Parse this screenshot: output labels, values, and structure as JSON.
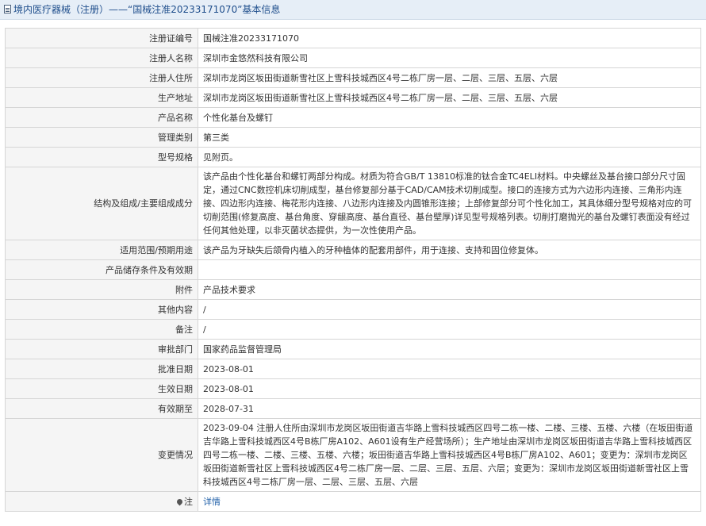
{
  "header": {
    "title": "境内医疗器械（注册）——“国械注准20233171070”基本信息",
    "icon": "document-icon"
  },
  "rows": [
    {
      "label": "注册证编号",
      "value": "国械注准20233171070"
    },
    {
      "label": "注册人名称",
      "value": "深圳市金悠然科技有限公司"
    },
    {
      "label": "注册人住所",
      "value": "深圳市龙岗区坂田街道新雪社区上雪科技城西区4号二栋厂房一层、二层、三层、五层、六层"
    },
    {
      "label": "生产地址",
      "value": "深圳市龙岗区坂田街道新雪社区上雪科技城西区4号二栋厂房一层、二层、三层、五层、六层"
    },
    {
      "label": "产品名称",
      "value": "个性化基台及螺钉"
    },
    {
      "label": "管理类别",
      "value": "第三类"
    },
    {
      "label": "型号规格",
      "value": "见附页。"
    },
    {
      "label": "结构及组成/主要组成成分",
      "value": "该产品由个性化基台和螺钉两部分构成。材质为符合GB/T 13810标准的钛合金TC4ELI材料。中央螺丝及基台接口部分尺寸固定，通过CNC数控机床切削成型，基台修复部分基于CAD/CAM技术切削成型。接口的连接方式为六边形内连接、三角形内连接、四边形内连接、梅花形内连接、八边形内连接及内圆锥形连接；上部修复部分可个性化加工，其具体细分型号规格对应的可切削范围(修复高度、基台角度、穿龈高度、基台直径、基台壁厚)详见型号规格列表。切削打磨抛光的基台及螺钉表面没有经过任何其他处理，以非灭菌状态提供，为一次性使用产品。"
    },
    {
      "label": "适用范围/预期用途",
      "value": "该产品为牙缺失后颌骨内植入的牙种植体的配套用部件，用于连接、支持和固位修复体。"
    },
    {
      "label": "产品储存条件及有效期",
      "value": ""
    },
    {
      "label": "附件",
      "value": "产品技术要求"
    },
    {
      "label": "其他内容",
      "value": "/"
    },
    {
      "label": "备注",
      "value": "/"
    },
    {
      "label": "审批部门",
      "value": "国家药品监督管理局"
    },
    {
      "label": "批准日期",
      "value": "2023-08-01"
    },
    {
      "label": "生效日期",
      "value": "2023-08-01"
    },
    {
      "label": "有效期至",
      "value": "2028-07-31"
    },
    {
      "label": "变更情况",
      "value": "2023-09-04 注册人住所由深圳市龙岗区坂田街道吉华路上雪科技城西区四号二栋一楼、二楼、三楼、五楼、六楼（在坂田街道吉华路上雪科技城西区4号B栋厂房A102、A601设有生产经营场所）；生产地址由深圳市龙岗区坂田街道吉华路上雪科技城西区四号二栋一楼、二楼、三楼、五楼、六楼；坂田街道吉华路上雪科技城西区4号B栋厂房A102、A601；变更为：深圳市龙岗区坂田街道新雪社区上雪科技城西区4号二栋厂房一层、二层、三层、五层、六层；变更为：深圳市龙岗区坂田街道新雪社区上雪科技城西区4号二栋厂房一层、二层、三层、五层、六层"
    }
  ],
  "note": {
    "label": "注",
    "icon": "pin-icon",
    "link": "详情"
  }
}
